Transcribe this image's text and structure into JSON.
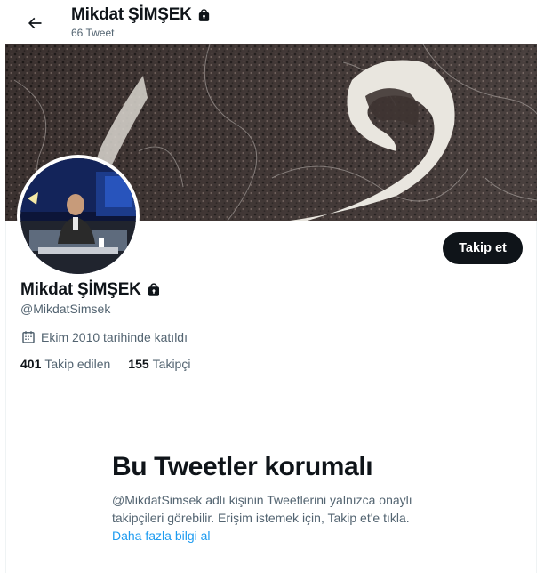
{
  "header": {
    "title": "Mikdat ŞİMŞEK",
    "tweet_count": "66 Tweet"
  },
  "profile": {
    "name": "Mikdat ŞİMŞEK",
    "handle": "@MikdatSimsek",
    "joined": "Ekim 2010 tarihinde katıldı",
    "following_count": "401",
    "following_label": "Takip edilen",
    "followers_count": "155",
    "followers_label": "Takipçi"
  },
  "actions": {
    "follow_label": "Takip et"
  },
  "protected": {
    "title": "Bu Tweetler korumalı",
    "body": "@MikdatSimsek adlı kişinin Tweetlerini yalnızca onaylı takipçileri görebilir. Erişim istemek için, Takip et'e tıkla.",
    "learn_more": "Daha fazla bilgi al"
  },
  "icons": [
    "back-arrow-icon",
    "lock-icon",
    "calendar-icon"
  ],
  "colors": {
    "accent": "#1d9bf0",
    "text": "#0f1419",
    "muted": "#536471"
  }
}
